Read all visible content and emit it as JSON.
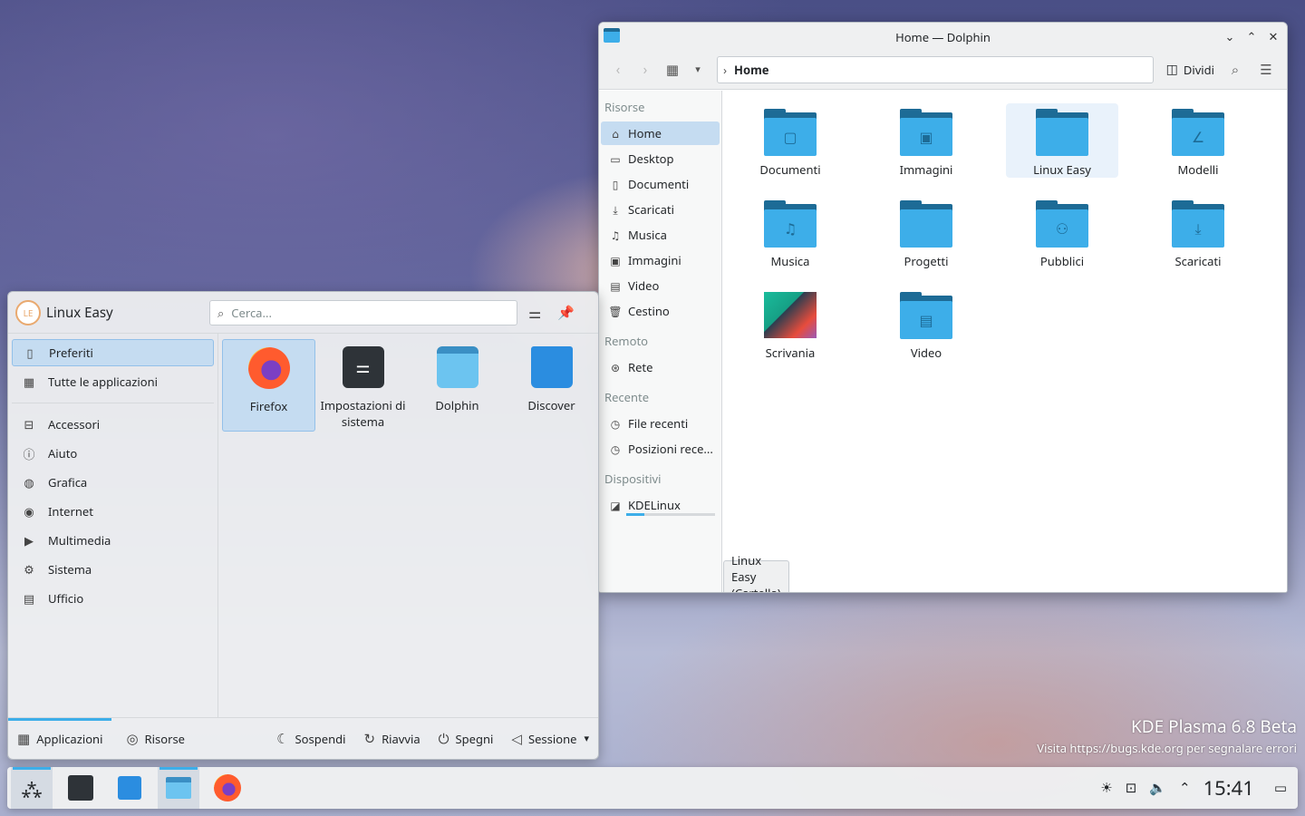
{
  "watermark": {
    "line1": "KDE Plasma 6.8 Beta",
    "line2": "Visita https://bugs.kde.org per segnalare errori"
  },
  "dolphin": {
    "title": "Home — Dolphin",
    "breadcrumb": "Home",
    "split_label": "Dividi",
    "sidebar": {
      "groups": [
        {
          "label": "Risorse",
          "items": [
            {
              "label": "Home",
              "icon": "home-icon"
            },
            {
              "label": "Desktop",
              "icon": "desktop-icon"
            },
            {
              "label": "Documenti",
              "icon": "document-icon"
            },
            {
              "label": "Scaricati",
              "icon": "download-icon"
            },
            {
              "label": "Musica",
              "icon": "music-icon"
            },
            {
              "label": "Immagini",
              "icon": "image-icon"
            },
            {
              "label": "Video",
              "icon": "video-icon"
            },
            {
              "label": "Cestino",
              "icon": "trash-icon"
            }
          ]
        },
        {
          "label": "Remoto",
          "items": [
            {
              "label": "Rete",
              "icon": "network-icon"
            }
          ]
        },
        {
          "label": "Recente",
          "items": [
            {
              "label": "File recenti",
              "icon": "recent-files-icon"
            },
            {
              "label": "Posizioni rece...",
              "icon": "recent-places-icon"
            }
          ]
        },
        {
          "label": "Dispositivi",
          "items": [
            {
              "label": "KDELinux",
              "icon": "drive-icon"
            }
          ]
        }
      ]
    },
    "files": [
      {
        "label": "Documenti",
        "icon": "document-icon"
      },
      {
        "label": "Immagini",
        "icon": "image-icon"
      },
      {
        "label": "Linux Easy",
        "icon": "folder-icon"
      },
      {
        "label": "Modelli",
        "icon": "template-icon"
      },
      {
        "label": "Musica",
        "icon": "music-icon"
      },
      {
        "label": "Progetti",
        "icon": "folder-icon"
      },
      {
        "label": "Pubblici",
        "icon": "people-icon"
      },
      {
        "label": "Scaricati",
        "icon": "download-icon"
      },
      {
        "label": "Scrivania",
        "icon": "desktop-thumbnail"
      },
      {
        "label": "Video",
        "icon": "video-icon"
      }
    ],
    "status": "Linux Easy (Cartella)"
  },
  "launcher": {
    "avatar": "LE",
    "user": "Linux Easy",
    "search_placeholder": "Cerca...",
    "top_items": [
      {
        "label": "Preferiti",
        "icon": "bookmark-icon"
      },
      {
        "label": "Tutte le applicazioni",
        "icon": "grid-icon"
      }
    ],
    "categories": [
      {
        "label": "Accessori",
        "icon": "accessories-icon"
      },
      {
        "label": "Aiuto",
        "icon": "help-icon"
      },
      {
        "label": "Grafica",
        "icon": "graphics-icon"
      },
      {
        "label": "Internet",
        "icon": "internet-icon"
      },
      {
        "label": "Multimedia",
        "icon": "multimedia-icon"
      },
      {
        "label": "Sistema",
        "icon": "gear-icon"
      },
      {
        "label": "Ufficio",
        "icon": "office-icon"
      }
    ],
    "apps": [
      {
        "label": "Firefox"
      },
      {
        "label": "Impostazioni di sistema"
      },
      {
        "label": "Dolphin"
      },
      {
        "label": "Discover"
      }
    ],
    "footer": {
      "apps": "Applicazioni",
      "places": "Risorse",
      "sleep": "Sospendi",
      "restart": "Riavvia",
      "shutdown": "Spegni",
      "session": "Sessione"
    }
  },
  "panel": {
    "clock": "15:41"
  }
}
